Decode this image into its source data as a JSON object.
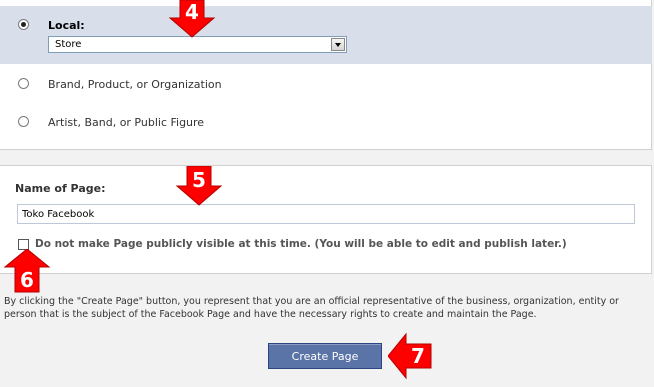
{
  "category_options": {
    "local": {
      "label": "Local:",
      "selected": true,
      "select_value": "Store"
    },
    "brand": {
      "label": "Brand, Product, or Organization",
      "selected": false
    },
    "artist": {
      "label": "Artist, Band, or Public Figure",
      "selected": false
    }
  },
  "name_section": {
    "label": "Name of Page:",
    "input_value": "Toko Facebook"
  },
  "visibility": {
    "checked": false,
    "label": "Do not make Page publicly visible at this time. (You will be able to edit and publish later.)"
  },
  "disclaimer": "By clicking the \"Create Page\" button, you represent that you are an official representative of the business, organization, entity or person that is the subject of the Facebook Page and have the necessary rights to create and maintain the Page.",
  "create_button_label": "Create Page",
  "callouts": [
    "4",
    "5",
    "6",
    "7"
  ],
  "colors": {
    "selected_row": "#d8dfea",
    "button": "#5b74a8",
    "callout_red": "#ff0000"
  }
}
